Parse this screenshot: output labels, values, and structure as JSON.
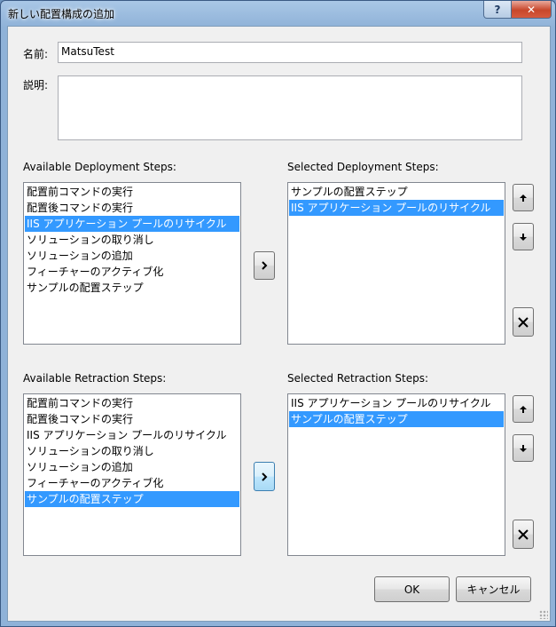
{
  "window": {
    "title": "新しい配置構成の追加",
    "help_label": "?",
    "close_label": "✕"
  },
  "form": {
    "name_label": "名前:",
    "name_value": "MatsuTest",
    "description_label": "説明:",
    "description_value": ""
  },
  "deployment": {
    "available_label": "Available Deployment Steps:",
    "selected_label": "Selected Deployment Steps:",
    "available_items": [
      {
        "label": "配置前コマンドの実行",
        "selected": false
      },
      {
        "label": "配置後コマンドの実行",
        "selected": false
      },
      {
        "label": "IIS アプリケーション プールのリサイクル",
        "selected": true
      },
      {
        "label": "ソリューションの取り消し",
        "selected": false
      },
      {
        "label": "ソリューションの追加",
        "selected": false
      },
      {
        "label": "フィーチャーのアクティブ化",
        "selected": false
      },
      {
        "label": "サンプルの配置ステップ",
        "selected": false
      }
    ],
    "selected_items": [
      {
        "label": "サンプルの配置ステップ",
        "selected": false
      },
      {
        "label": "IIS アプリケーション プールのリサイクル",
        "selected": true
      }
    ],
    "add_label": "›"
  },
  "retraction": {
    "available_label": "Available Retraction Steps:",
    "selected_label": "Selected Retraction Steps:",
    "available_items": [
      {
        "label": "配置前コマンドの実行",
        "selected": false
      },
      {
        "label": "配置後コマンドの実行",
        "selected": false
      },
      {
        "label": "IIS アプリケーション プールのリサイクル",
        "selected": false
      },
      {
        "label": "ソリューションの取り消し",
        "selected": false
      },
      {
        "label": "ソリューションの追加",
        "selected": false
      },
      {
        "label": "フィーチャーのアクティブ化",
        "selected": false
      },
      {
        "label": "サンプルの配置ステップ",
        "selected": true
      }
    ],
    "selected_items": [
      {
        "label": "IIS アプリケーション プールのリサイクル",
        "selected": false
      },
      {
        "label": "サンプルの配置ステップ",
        "selected": true
      }
    ],
    "add_label": "›"
  },
  "icons": {
    "up": "up-arrow-icon",
    "down": "down-arrow-icon",
    "remove": "remove-x-icon",
    "add": "chevron-right-icon"
  },
  "footer": {
    "ok_label": "OK",
    "cancel_label": "キャンセル"
  },
  "colors": {
    "selection": "#3399ff",
    "frame": "#8fb2d8",
    "client": "#f0f0f0"
  }
}
